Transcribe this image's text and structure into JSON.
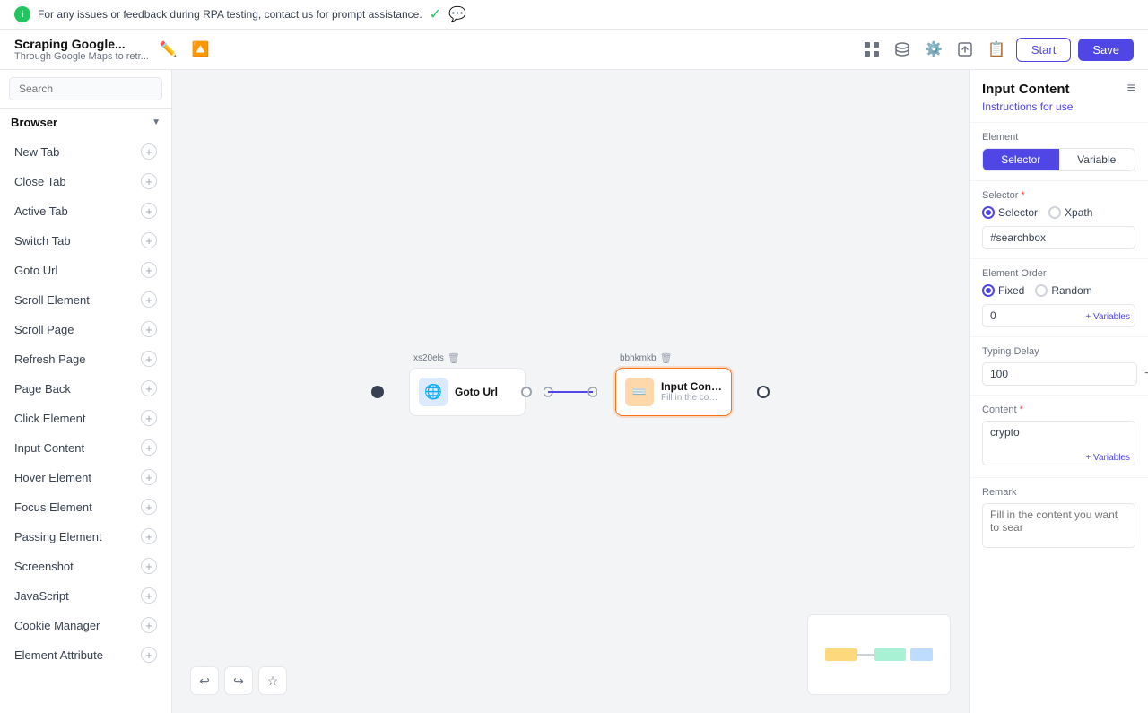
{
  "notification": {
    "text": "For any issues or feedback during RPA testing, contact us for prompt assistance."
  },
  "toolbar": {
    "project_title": "Scraping Google...",
    "project_subtitle": "Through Google Maps to retr...",
    "start_label": "Start",
    "save_label": "Save"
  },
  "sidebar": {
    "search_placeholder": "Search",
    "section_label": "Browser",
    "items": [
      {
        "label": "New Tab"
      },
      {
        "label": "Close Tab"
      },
      {
        "label": "Active Tab"
      },
      {
        "label": "Switch Tab"
      },
      {
        "label": "Goto Url"
      },
      {
        "label": "Scroll Element"
      },
      {
        "label": "Scroll Page"
      },
      {
        "label": "Refresh Page"
      },
      {
        "label": "Page Back"
      },
      {
        "label": "Click Element"
      },
      {
        "label": "Input Content"
      },
      {
        "label": "Hover Element"
      },
      {
        "label": "Focus Element"
      },
      {
        "label": "Passing Element"
      },
      {
        "label": "Screenshot"
      },
      {
        "label": "JavaScript"
      },
      {
        "label": "Cookie Manager"
      },
      {
        "label": "Element Attribute"
      }
    ]
  },
  "canvas": {
    "node1": {
      "badge": "xs20els",
      "name": "Goto Url",
      "desc": ""
    },
    "node2": {
      "badge": "bbhkmkb",
      "name": "Input Content",
      "desc": "Fill in the cont..."
    }
  },
  "right_panel": {
    "title": "Input Content",
    "instructions_link": "Instructions for use",
    "element_label": "Element",
    "selector_btn": "Selector",
    "variable_btn": "Variable",
    "selector_label": "Selector",
    "selector_radio_selector": "Selector",
    "selector_radio_xpath": "Xpath",
    "selector_value": "#searchbox",
    "element_order_label": "Element Order",
    "order_radio_fixed": "Fixed",
    "order_radio_random": "Random",
    "order_value": "0",
    "variables_link": "+ Variables",
    "typing_delay_label": "Typing Delay",
    "typing_delay_value": "100",
    "content_label": "Content",
    "content_value": "crypto",
    "content_variables_link": "+ Variables",
    "remark_label": "Remark",
    "remark_placeholder": "Fill in the content you want to sear"
  },
  "canvas_tools": {
    "undo_label": "↩",
    "redo_label": "↪",
    "star_label": "☆"
  }
}
